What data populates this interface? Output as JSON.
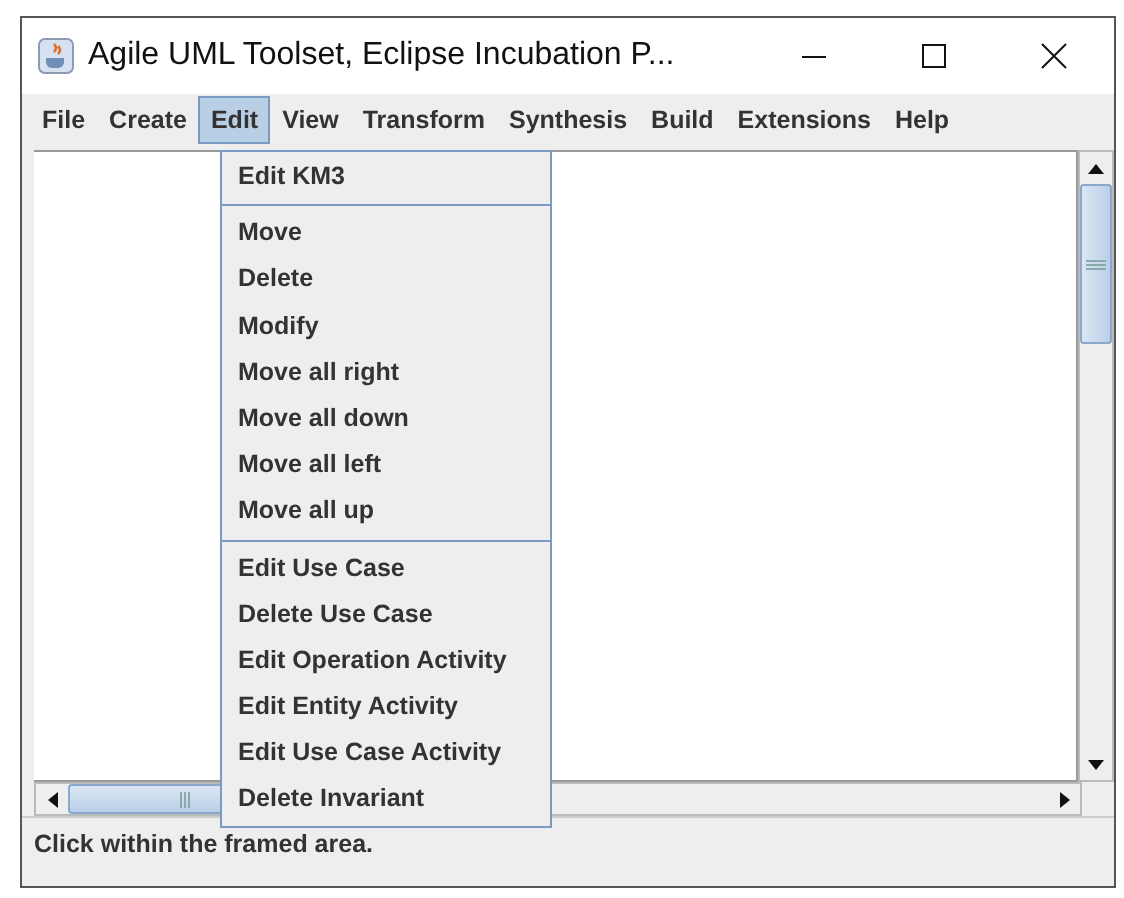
{
  "window": {
    "title": "Agile UML Toolset, Eclipse Incubation P..."
  },
  "menu_bar": [
    {
      "label": "File",
      "selected": false
    },
    {
      "label": "Create",
      "selected": false
    },
    {
      "label": "Edit",
      "selected": true
    },
    {
      "label": "View",
      "selected": false
    },
    {
      "label": "Transform",
      "selected": false
    },
    {
      "label": "Synthesis",
      "selected": false
    },
    {
      "label": "Build",
      "selected": false
    },
    {
      "label": "Extensions",
      "selected": false
    },
    {
      "label": "Help",
      "selected": false
    }
  ],
  "edit_menu": [
    [
      {
        "label": "Edit KM3"
      }
    ],
    [
      {
        "label": "Move"
      },
      {
        "label": "Delete"
      },
      {
        "label": "Modify"
      },
      {
        "label": "Move all right"
      },
      {
        "label": "Move all down"
      },
      {
        "label": "Move all left"
      },
      {
        "label": "Move all up"
      }
    ],
    [
      {
        "label": "Edit Use Case"
      },
      {
        "label": "Delete Use Case"
      },
      {
        "label": "Edit Operation Activity"
      },
      {
        "label": "Edit Entity Activity"
      },
      {
        "label": "Edit Use Case Activity"
      },
      {
        "label": "Delete Invariant"
      }
    ]
  ],
  "status_bar": "Click within the framed area."
}
